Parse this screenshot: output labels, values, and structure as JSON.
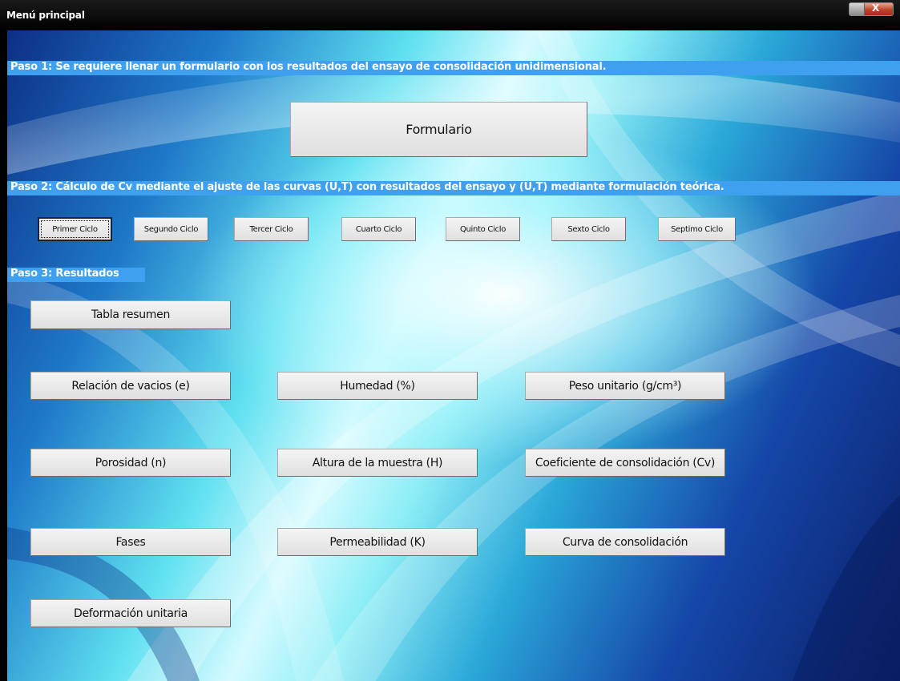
{
  "window": {
    "title": "Menú principal",
    "close_glyph": "X"
  },
  "steps": {
    "step1": "Paso 1: Se requiere llenar un formulario con los resultados del ensayo de consolidación unidimensional.",
    "step2": "Paso 2: Cálculo de Cv mediante el ajuste de las curvas (U,T) con resultados del ensayo y (U,T) mediante formulación teórica.",
    "step3": "Paso 3: Resultados"
  },
  "buttons": {
    "formulario": "Formulario",
    "cycles": [
      "Primer Ciclo",
      "Segundo Ciclo",
      "Tercer Ciclo",
      "Cuarto Ciclo",
      "Quinto Ciclo",
      "Sexto Ciclo",
      "Septimo Ciclo"
    ],
    "tabla_resumen": "Tabla resumen",
    "relacion_vacios": "Relación de vacios (e)",
    "humedad": "Humedad (%)",
    "peso_unitario": "Peso unitario (g/cm³)",
    "porosidad": "Porosidad (n)",
    "altura_muestra": "Altura de la muestra (H)",
    "coef_consolidacion": "Coeficiente de consolidación (Cv)",
    "fases": "Fases",
    "permeabilidad": "Permeabilidad (K)",
    "curva_consolidacion": "Curva de consolidación",
    "deformacion_unitaria": "Deformación unitaria"
  },
  "colors": {
    "step_band": "#3fa0f0",
    "title_bar": "#000000",
    "close_button": "#c1412b"
  }
}
